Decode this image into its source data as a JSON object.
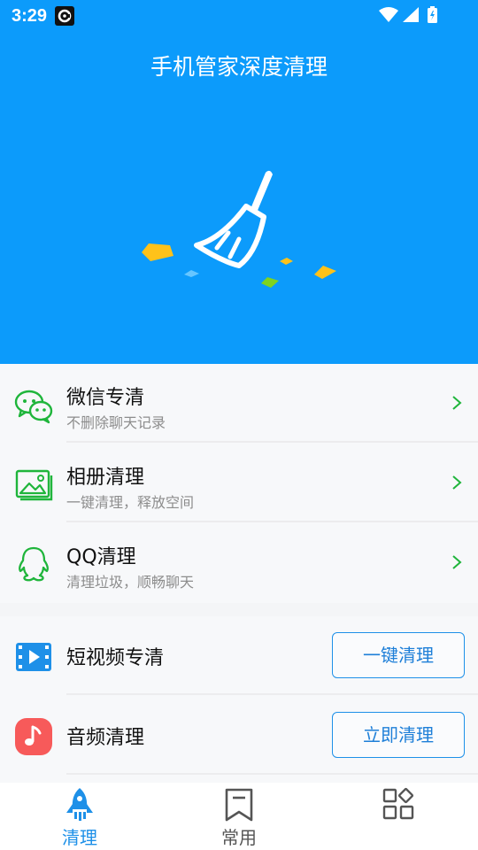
{
  "status_bar": {
    "time": "3:29"
  },
  "header": {
    "title": "手机管家深度清理"
  },
  "clean_list": [
    {
      "title": "微信专清",
      "subtitle": "不删除聊天记录",
      "icon": "wechat-icon"
    },
    {
      "title": "相册清理",
      "subtitle": "一键清理，释放空间",
      "icon": "gallery-icon"
    },
    {
      "title": "QQ清理",
      "subtitle": "清理垃圾，顺畅聊天",
      "icon": "qq-icon"
    }
  ],
  "action_list": [
    {
      "title": "短视频专清",
      "button": "一键清理",
      "icon": "video-icon"
    },
    {
      "title": "音频清理",
      "button": "立即清理",
      "icon": "music-icon"
    }
  ],
  "tabbar": {
    "tabs": [
      {
        "label": "清理",
        "icon": "rocket-icon",
        "active": true
      },
      {
        "label": "常用",
        "icon": "bookmark-icon",
        "active": false
      },
      {
        "label": "",
        "icon": "apps-grid-icon",
        "active": false
      }
    ]
  },
  "colors": {
    "header_bg": "#0c9bfb",
    "accent": "#1e90e8",
    "wechat_green": "#1fb53b",
    "audio_red": "#f75a5a"
  }
}
